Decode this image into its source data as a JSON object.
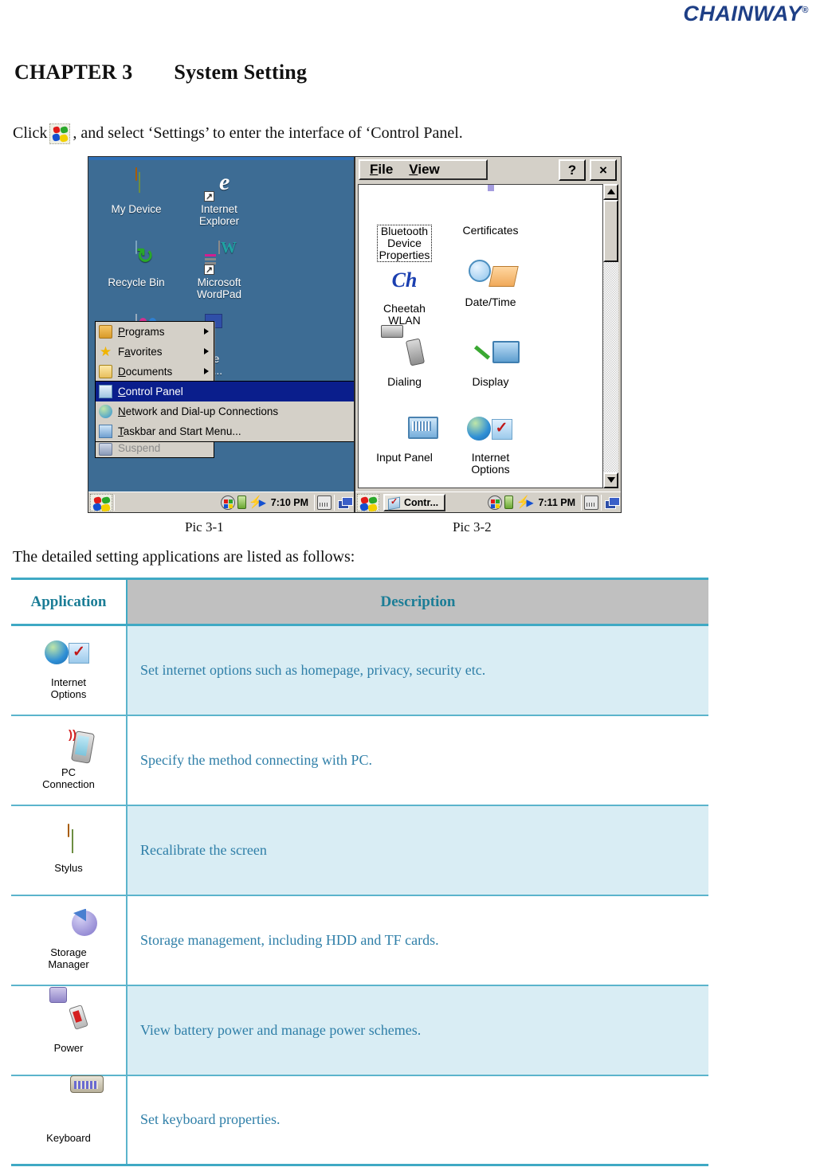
{
  "header": {
    "brand": "CHAINWAY",
    "registered_mark": "®"
  },
  "chapter": {
    "number": "CHAPTER 3",
    "title": "System Setting"
  },
  "intro": {
    "before_icon": "Click",
    "icon_name": "windows-start-flag-icon",
    "after_icon": ", and select ‘Settings’ to enter the interface of ‘Control Panel."
  },
  "pic1": {
    "caption": "Pic 3-1",
    "desktop_icons": [
      {
        "label_line1": "My Device",
        "label_line2": "",
        "icon": "handheld-device-icon"
      },
      {
        "label_line1": "Internet",
        "label_line2": "Explorer",
        "icon": "internet-explorer-icon"
      },
      {
        "label_line1": "Recycle Bin",
        "label_line2": "",
        "icon": "recycle-bin-icon"
      },
      {
        "label_line1": "Microsoft",
        "label_line2": "WordPad",
        "icon": "wordpad-icon"
      }
    ],
    "start_menu": [
      {
        "label": "Programs",
        "accel": "P",
        "icon": "folder-programs-icon",
        "has_submenu": true
      },
      {
        "label": "Favorites",
        "accel": "a",
        "icon": "star-favorites-icon",
        "has_submenu": true
      },
      {
        "label": "Documents",
        "accel": "D",
        "icon": "documents-icon",
        "has_submenu": true
      }
    ],
    "settings_submenu": [
      {
        "label": "Control Panel",
        "accel": "C",
        "icon": "control-panel-icon",
        "selected": true
      },
      {
        "label": "Network and Dial-up Connections",
        "accel": "N",
        "icon": "network-globe-icon",
        "selected": false
      },
      {
        "label": "Taskbar and Start Menu...",
        "accel": "T",
        "icon": "taskbar-icon",
        "selected": false
      }
    ],
    "obscured_menu_item": "Suspend",
    "taskbar": {
      "start_icon": "windows-start-flag-icon",
      "clock": "7:10 PM",
      "tray_icons": [
        "network-status-icon",
        "battery-icon",
        "charging-bolt-icon",
        "play-arrow-icon",
        "keyboard-input-icon",
        "desktop-windows-icon"
      ]
    }
  },
  "pic2": {
    "caption": "Pic 3-2",
    "menubar": [
      {
        "label": "File",
        "accel": "F"
      },
      {
        "label": "View",
        "accel": "V"
      }
    ],
    "window_buttons": [
      {
        "label": "?",
        "name": "help-button"
      },
      {
        "label": "×",
        "name": "close-button"
      }
    ],
    "control_panel_items": [
      {
        "label_line1": "Bluetooth",
        "label_line2": "Device",
        "label_line3": "Properties",
        "icon": "bluetooth-icon",
        "selected": true
      },
      {
        "label_line1": "Certificates",
        "label_line2": "",
        "label_line3": "",
        "icon": "certificates-gear-icon",
        "selected": false
      },
      {
        "label_line1": "Cheetah",
        "label_line2": "WLAN",
        "label_line3": "",
        "icon": "cheetah-wlan-icon",
        "selected": false
      },
      {
        "label_line1": "Date/Time",
        "label_line2": "",
        "label_line3": "",
        "icon": "date-time-icon",
        "selected": false
      },
      {
        "label_line1": "Dialing",
        "label_line2": "",
        "label_line3": "",
        "icon": "dialing-icon",
        "selected": false
      },
      {
        "label_line1": "Display",
        "label_line2": "",
        "label_line3": "",
        "icon": "display-icon",
        "selected": false
      },
      {
        "label_line1": "Input Panel",
        "label_line2": "",
        "label_line3": "",
        "icon": "input-panel-icon",
        "selected": false
      },
      {
        "label_line1": "Internet",
        "label_line2": "Options",
        "label_line3": "",
        "icon": "internet-options-icon",
        "selected": false
      }
    ],
    "cheetah_glyph": "Ch",
    "taskbar": {
      "start_icon": "windows-start-flag-icon",
      "task_button": "Contr...",
      "clock": "7:11 PM"
    }
  },
  "lead_sentence": "The detailed setting applications are listed as follows:",
  "table": {
    "headers": [
      "Application",
      "Description"
    ],
    "rows": [
      {
        "app_line1": "Internet",
        "app_line2": "Options",
        "icon": "internet-options-icon",
        "description": "Set internet options such as homepage, privacy, security etc."
      },
      {
        "app_line1": "PC",
        "app_line2": "Connection",
        "icon": "pc-connection-icon",
        "description": "Specify the method connecting with PC."
      },
      {
        "app_line1": "Stylus",
        "app_line2": "",
        "icon": "stylus-icon",
        "description": "Recalibrate the screen"
      },
      {
        "app_line1": "Storage",
        "app_line2": "Manager",
        "icon": "storage-manager-icon",
        "description": "Storage management, including HDD and TF cards."
      },
      {
        "app_line1": "Power",
        "app_line2": "",
        "icon": "power-icon",
        "description": "View battery power and manage power schemes."
      },
      {
        "app_line1": "Keyboard",
        "app_line2": "",
        "icon": "keyboard-icon",
        "description": "Set keyboard properties."
      }
    ]
  },
  "colors": {
    "brand_blue": "#1e3f86",
    "table_accent": "#3fa9c4",
    "table_header_bg": "#c0c0c0",
    "table_header_text": "#1b7d96",
    "table_alt_row": "#d9edf4",
    "description_text": "#2f7fa8"
  }
}
